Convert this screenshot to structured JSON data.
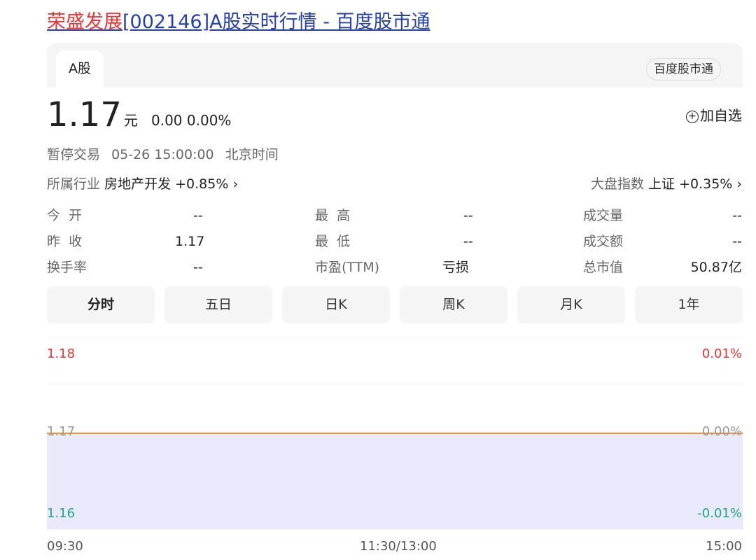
{
  "page": {
    "title_highlight": "荣盛发展",
    "title_rest": "[002146]A股实时行情 - 百度股市通"
  },
  "card": {
    "tab_label": "A股",
    "source_badge": "百度股市通",
    "add_watch": "加自选"
  },
  "quote": {
    "price": "1.17",
    "unit": "元",
    "change": "0.00",
    "change_pct": "0.00%",
    "status": "暂停交易",
    "date_time": "05-26 15:00:00",
    "timezone": "北京时间"
  },
  "industry": {
    "label": "所属行业",
    "name": "房地产开发",
    "change": "+0.85%",
    "arrow": "›"
  },
  "market_index": {
    "label": "大盘指数",
    "name": "上证",
    "change": "+0.35%",
    "arrow": "›"
  },
  "stats": {
    "open": {
      "label": "今  开",
      "value": "--"
    },
    "prev_close": {
      "label": "昨  收",
      "value": "1.17"
    },
    "turnover": {
      "label": "换手率",
      "value": "--"
    },
    "high": {
      "label": "最  高",
      "value": "--"
    },
    "low": {
      "label": "最  低",
      "value": "--"
    },
    "pe": {
      "label": "市盈(TTM)",
      "value": "亏损"
    },
    "volume": {
      "label": "成交量",
      "value": "--"
    },
    "amount": {
      "label": "成交额",
      "value": "--"
    },
    "market_cap": {
      "label": "总市值",
      "value": "50.87亿"
    }
  },
  "chart_tabs": [
    "分时",
    "五日",
    "日K",
    "周K",
    "月K",
    "1年"
  ],
  "colors": {
    "red": "#f73131",
    "green": "#1da67f",
    "line": "#f09230",
    "fill": "#e8eafc",
    "link": "#2440b3"
  },
  "chart_data": {
    "type": "line",
    "y_left_labels": [
      "1.18",
      "1.17",
      "1.16"
    ],
    "y_right_labels": [
      "0.01%",
      "0.00%",
      "-0.01%"
    ],
    "x_labels": [
      "09:30",
      "11:30/13:00",
      "15:00"
    ],
    "ylim": [
      1.16,
      1.18
    ],
    "series": [
      {
        "values": [
          1.17,
          1.17
        ]
      }
    ],
    "baseline": 1.17
  }
}
